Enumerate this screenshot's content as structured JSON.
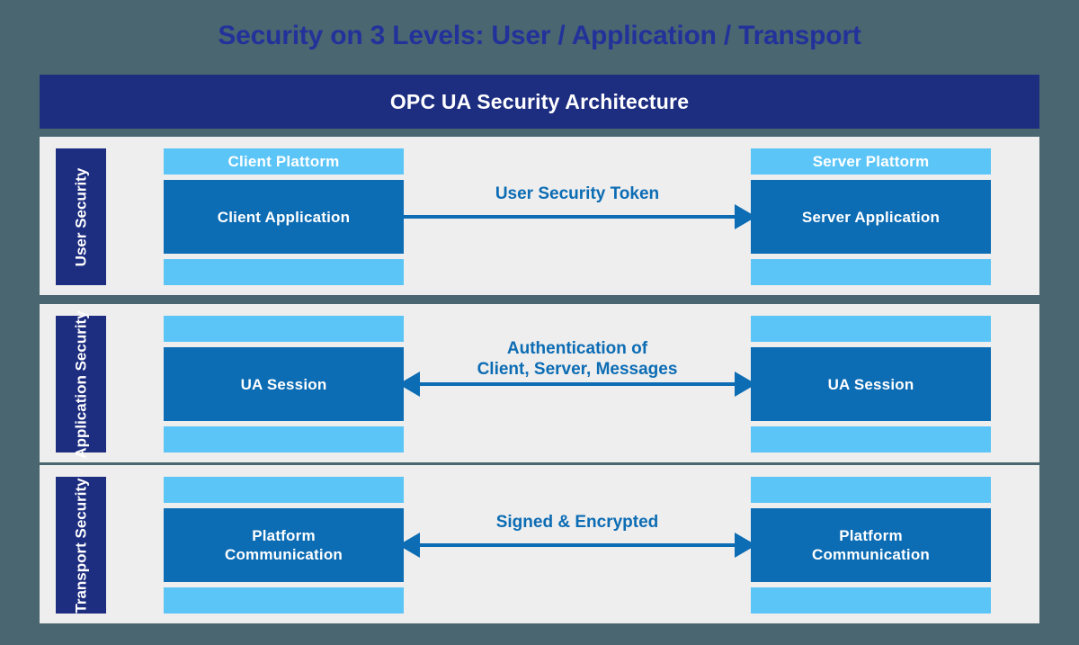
{
  "page": {
    "title": "Security on 3 Levels: User / Application / Transport",
    "background_color": "#4a6670",
    "title_color": "#22329a"
  },
  "header": {
    "title": "OPC UA Security Architecture",
    "background_color": "#1d2d80",
    "text_color": "#ffffff"
  },
  "colors": {
    "panel": "#eeeeee",
    "navy": "#1d2d80",
    "blue": "#0c6cb4",
    "light_blue": "#5cc5f7",
    "arrow": "#0c6cb4"
  },
  "levels": [
    {
      "label": "User\nSecurity",
      "left": {
        "top_bar_label": "Client Plattorm",
        "main_label": "Client Application",
        "bottom_bar_label": ""
      },
      "right": {
        "top_bar_label": "Server Plattorm",
        "main_label": "Server Application",
        "bottom_bar_label": ""
      },
      "connector": {
        "label": "User Security Token",
        "lines": 1,
        "direction": "right"
      }
    },
    {
      "label": "Application\nSecurity",
      "left": {
        "top_bar_label": "",
        "main_label": "UA Session",
        "bottom_bar_label": ""
      },
      "right": {
        "top_bar_label": "",
        "main_label": "UA Session",
        "bottom_bar_label": ""
      },
      "connector": {
        "label": "Authentication of\nClient, Server, Messages",
        "lines": 2,
        "direction": "both"
      }
    },
    {
      "label": "Transport\nSecurity",
      "left": {
        "top_bar_label": "",
        "main_label": "Platform\nCommunication",
        "bottom_bar_label": ""
      },
      "right": {
        "top_bar_label": "",
        "main_label": "Platform\nCommunication",
        "bottom_bar_label": ""
      },
      "connector": {
        "label": "Signed & Encrypted",
        "lines": 1,
        "direction": "both"
      }
    }
  ]
}
